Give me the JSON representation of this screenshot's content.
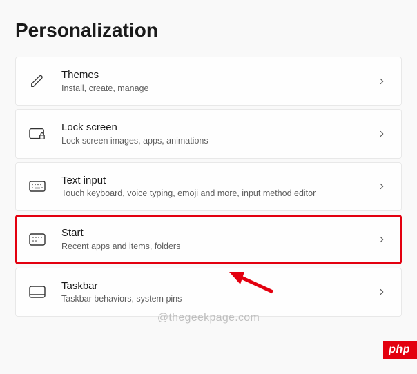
{
  "page_title": "Personalization",
  "items": [
    {
      "title": "Themes",
      "desc": "Install, create, manage"
    },
    {
      "title": "Lock screen",
      "desc": "Lock screen images, apps, animations"
    },
    {
      "title": "Text input",
      "desc": "Touch keyboard, voice typing, emoji and more, input method editor"
    },
    {
      "title": "Start",
      "desc": "Recent apps and items, folders"
    },
    {
      "title": "Taskbar",
      "desc": "Taskbar behaviors, system pins"
    }
  ],
  "watermark": "@thegeekpage.com",
  "badge": "php"
}
